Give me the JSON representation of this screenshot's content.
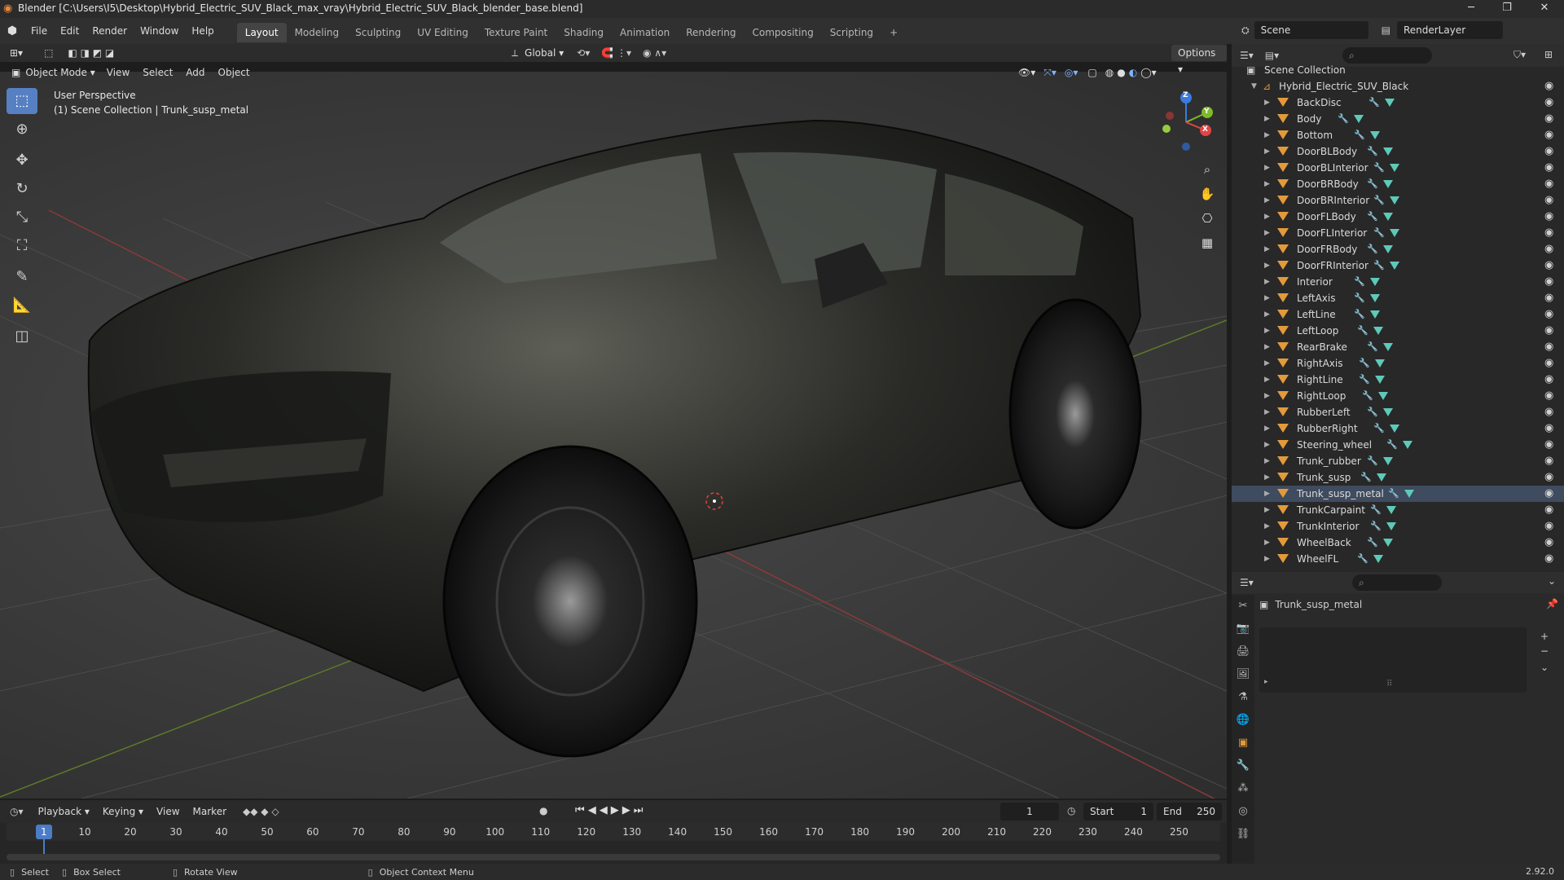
{
  "titlebar": {
    "title": "Blender [C:\\Users\\I5\\Desktop\\Hybrid_Electric_SUV_Black_max_vray\\Hybrid_Electric_SUV_Black_blender_base.blend]",
    "minimize": "─",
    "restore": "❐",
    "close": "✕"
  },
  "menu": [
    "File",
    "Edit",
    "Render",
    "Window",
    "Help"
  ],
  "workspaces": [
    "Layout",
    "Modeling",
    "Sculpting",
    "UV Editing",
    "Texture Paint",
    "Shading",
    "Animation",
    "Rendering",
    "Compositing",
    "Scripting"
  ],
  "workspace_active": "Layout",
  "scene": {
    "label": "Scene",
    "render_layer": "RenderLayer"
  },
  "viewport_header": {
    "mode": "Object Mode",
    "menus": [
      "View",
      "Select",
      "Add",
      "Object"
    ],
    "transform": "Global",
    "options": "Options"
  },
  "viewport_overlay": {
    "line1": "User Perspective",
    "line2": "(1) Scene Collection | Trunk_susp_metal"
  },
  "gizmo": {
    "z": "Z",
    "y": "Y",
    "x": "X"
  },
  "outliner": {
    "root": "Scene Collection",
    "collection": "Hybrid_Electric_SUV_Black",
    "items": [
      "BackDisc",
      "Body",
      "Bottom",
      "DoorBLBody",
      "DoorBLInterior",
      "DoorBRBody",
      "DoorBRInterior",
      "DoorFLBody",
      "DoorFLInterior",
      "DoorFRBody",
      "DoorFRInterior",
      "Interior",
      "LeftAxis",
      "LeftLine",
      "LeftLoop",
      "RearBrake",
      "RightAxis",
      "RightLine",
      "RightLoop",
      "RubberLeft",
      "RubberRight",
      "Steering_wheel",
      "Trunk_rubber",
      "Trunk_susp",
      "Trunk_susp_metal",
      "TrunkCarpaint",
      "TrunkInterior",
      "WheelBack",
      "WheelFL"
    ],
    "selected": "Trunk_susp_metal"
  },
  "properties": {
    "object_name": "Trunk_susp_metal"
  },
  "timeline": {
    "menus": [
      "Playback",
      "Keying",
      "View",
      "Marker"
    ],
    "current_frame": "1",
    "start_label": "Start",
    "start": "1",
    "end_label": "End",
    "end": "250",
    "ticks": [
      "1",
      "10",
      "20",
      "30",
      "40",
      "50",
      "60",
      "70",
      "80",
      "90",
      "100",
      "110",
      "120",
      "130",
      "140",
      "150",
      "160",
      "170",
      "180",
      "190",
      "200",
      "210",
      "220",
      "230",
      "240",
      "250"
    ]
  },
  "statusbar": {
    "select": "Select",
    "box_select": "Box Select",
    "rotate": "Rotate View",
    "context": "Object Context Menu",
    "version": "2.92.0"
  },
  "colors": {
    "accent": "#5680c2",
    "object": "#e39a3b",
    "mesh": "#5ec9b9"
  }
}
